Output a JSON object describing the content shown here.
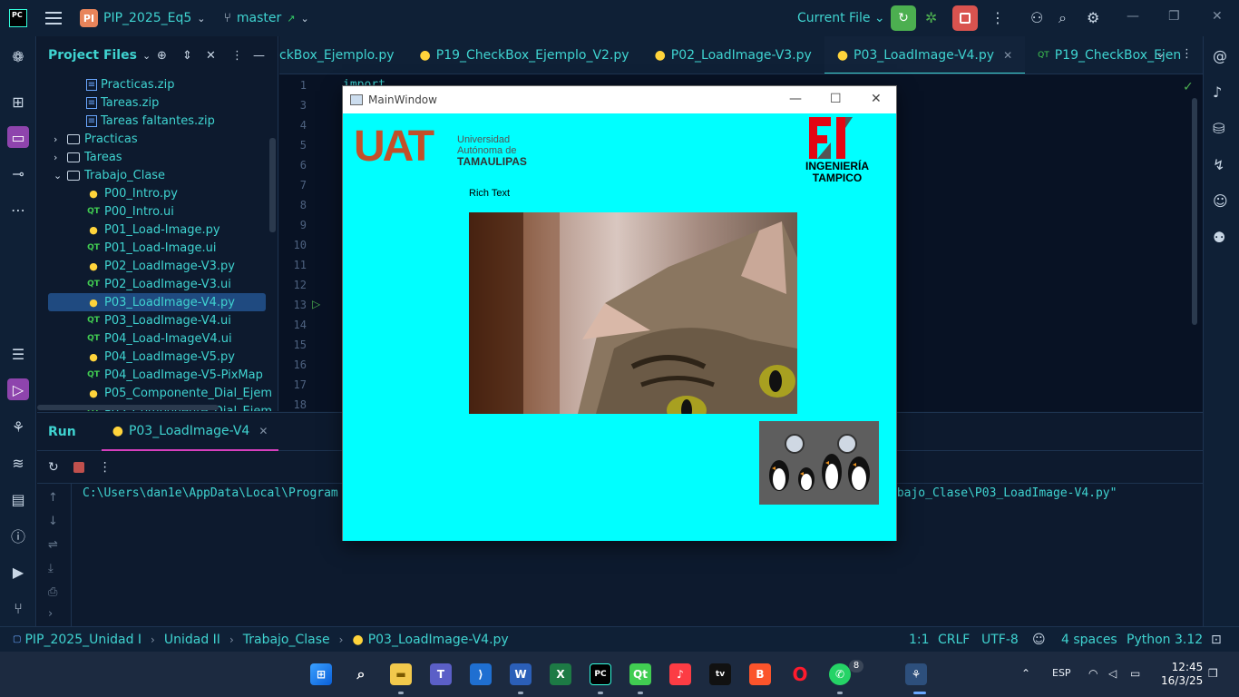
{
  "topbar": {
    "logo": "PC",
    "project_badge": "PI",
    "project_name": "PIP_2025_Eq5",
    "branch": "master",
    "run_config": "Current File"
  },
  "project_panel": {
    "title": "Project Files",
    "items": [
      {
        "label": "Practicas.zip",
        "type": "zip",
        "indent": 3
      },
      {
        "label": "Tareas.zip",
        "type": "zip",
        "indent": 3
      },
      {
        "label": "Tareas faltantes.zip",
        "type": "zip",
        "indent": 3
      },
      {
        "label": "Practicas",
        "type": "folder",
        "indent": 2,
        "arrow": "›"
      },
      {
        "label": "Tareas",
        "type": "folder",
        "indent": 2,
        "arrow": "›"
      },
      {
        "label": "Trabajo_Clase",
        "type": "folder",
        "indent": 2,
        "arrow": "⌄"
      },
      {
        "label": "P00_Intro.py",
        "type": "py",
        "indent": 3
      },
      {
        "label": "P00_Intro.ui",
        "type": "qt",
        "indent": 3
      },
      {
        "label": "P01_Load-Image.py",
        "type": "py",
        "indent": 3
      },
      {
        "label": "P01_Load-Image.ui",
        "type": "qt",
        "indent": 3
      },
      {
        "label": "P02_LoadImage-V3.py",
        "type": "py",
        "indent": 3
      },
      {
        "label": "P02_LoadImage-V3.ui",
        "type": "qt",
        "indent": 3
      },
      {
        "label": "P03_LoadImage-V4.py",
        "type": "py",
        "indent": 3,
        "selected": true
      },
      {
        "label": "P03_LoadImage-V4.ui",
        "type": "qt",
        "indent": 3
      },
      {
        "label": "P04_Load-ImageV4.ui",
        "type": "qt",
        "indent": 3
      },
      {
        "label": "P04_LoadImage-V5.py",
        "type": "py",
        "indent": 3
      },
      {
        "label": "P04_LoadImage-V5-PixMap",
        "type": "qt",
        "indent": 3
      },
      {
        "label": "P05_Componente_Dial_Ejem",
        "type": "py",
        "indent": 3
      },
      {
        "label": "P05_Componente_Dial_Ejem",
        "type": "qt",
        "indent": 3
      }
    ]
  },
  "editor": {
    "tabs": [
      {
        "label": "ckBox_Ejemplo.py",
        "icon": "python-icon"
      },
      {
        "label": "P19_CheckBox_Ejemplo_V2.py",
        "icon": "python-icon"
      },
      {
        "label": "P02_LoadImage-V3.py",
        "icon": "python-icon"
      },
      {
        "label": "P03_LoadImage-V4.py",
        "icon": "python-icon",
        "active": true
      },
      {
        "label": "P19_CheckBox_Ejen",
        "icon": "qt-icon"
      }
    ],
    "line_numbers": [
      "1",
      "3",
      "4",
      "5",
      "6",
      "7",
      "8",
      "9",
      "10",
      "11",
      "12",
      "13",
      "14",
      "15",
      "16",
      "17",
      "18"
    ],
    "code_first_line": "import"
  },
  "run_panel": {
    "label": "Run",
    "tab": "P03_LoadImage-V4",
    "console_left": "C:\\Users\\dan1e\\AppData\\Local\\Program",
    "console_right": "abajo_Clase\\P03_LoadImage-V4.py\""
  },
  "statusbar": {
    "crumbs": [
      "PIP_2025_Unidad I",
      "Unidad II",
      "Trabajo_Clase",
      "P03_LoadImage-V4.py"
    ],
    "position": "1:1",
    "line_sep": "CRLF",
    "encoding": "UTF-8",
    "indent": "4 spaces",
    "interpreter": "Python 3.12"
  },
  "mainwindow": {
    "title": "MainWindow",
    "label_text": "Rich Text",
    "uat_logo_line1": "Universidad",
    "uat_logo_line2": "Autónoma de",
    "uat_logo_line3": "TAMAULIPAS",
    "uat_logo_mark": "UAT",
    "fi_logo_line1": "INGENIERÍA",
    "fi_logo_line2": "TAMPICO",
    "background_color": "#00ffff"
  },
  "taskbar": {
    "lang": "ESP",
    "time": "12:45",
    "date": "16/3/25",
    "whatsapp_badge": "8"
  }
}
